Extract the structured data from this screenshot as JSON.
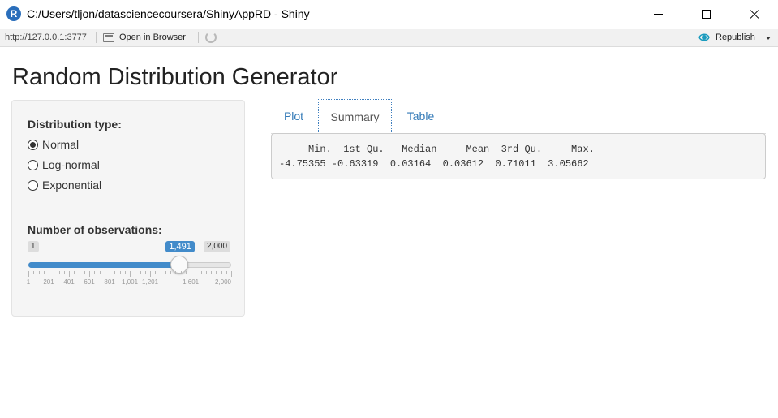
{
  "window": {
    "icon_letter": "R",
    "title": "C:/Users/tljon/datasciencecoursera/ShinyAppRD - Shiny",
    "controls": [
      "minimize-icon",
      "maximize-icon",
      "close-icon"
    ]
  },
  "toolbar": {
    "url": "http://127.0.0.1:3777",
    "open_in_browser": "Open in Browser",
    "republish": "Republish",
    "accent": "#1a9bbe"
  },
  "page": {
    "title": "Random Distribution Generator"
  },
  "sidebar": {
    "dist_label": "Distribution type:",
    "dist_options": [
      "Normal",
      "Log-normal",
      "Exponential"
    ],
    "dist_selected": "Normal",
    "obs_label": "Number of observations:",
    "slider": {
      "min": 1,
      "max": 2000,
      "value": 1491,
      "min_label": "1",
      "max_label": "2,000",
      "value_label": "1,491",
      "tick_values": [
        1,
        201,
        401,
        601,
        801,
        1001,
        1201,
        1601,
        2000
      ],
      "tick_labels": [
        "1",
        "201",
        "401",
        "601",
        "801",
        "1,001",
        "1,201",
        "1,601",
        "2,000"
      ],
      "accent": "#428bca"
    }
  },
  "tabs": {
    "items": [
      "Plot",
      "Summary",
      "Table"
    ],
    "active": "Summary"
  },
  "summary_output": {
    "header": "     Min.  1st Qu.   Median     Mean  3rd Qu.     Max. ",
    "values": "-4.75355 -0.63319  0.03164  0.03612  0.71011  3.05662 "
  }
}
